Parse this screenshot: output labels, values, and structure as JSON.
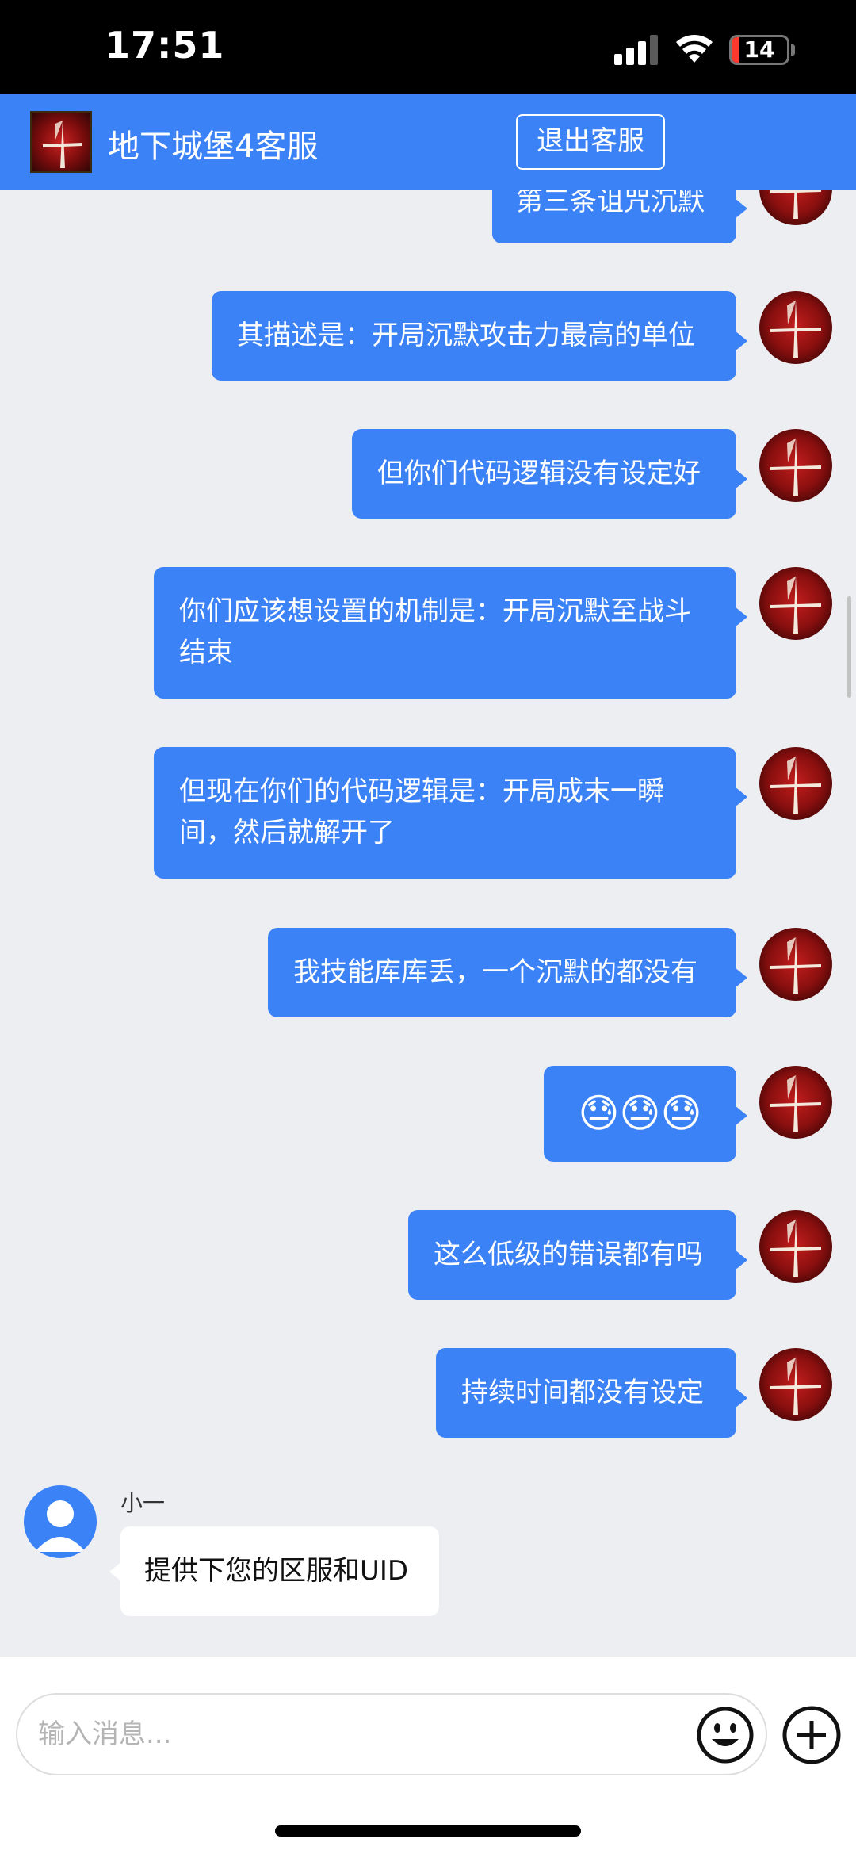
{
  "status_bar": {
    "time": "17:51",
    "battery": "14",
    "battery_level": 0.14
  },
  "header": {
    "title": "地下城堡4客服",
    "exit_label": "退出客服"
  },
  "messages": [
    {
      "side": "right",
      "text": "第三条诅咒沉默"
    },
    {
      "side": "right",
      "text": "其描述是：开局沉默攻击力最高的单位"
    },
    {
      "side": "right",
      "text": "但你们代码逻辑没有设定好"
    },
    {
      "side": "right",
      "text": "你们应该想设置的机制是：开局沉默至战斗结束"
    },
    {
      "side": "right",
      "text": "但现在你们的代码逻辑是：开局成末一瞬间，然后就解开了"
    },
    {
      "side": "right",
      "text": "我技能库库丢，一个沉默的都没有"
    },
    {
      "side": "right",
      "text": "😓😓😓"
    },
    {
      "side": "right",
      "text": "这么低级的错误都有吗"
    },
    {
      "side": "right",
      "text": "持续时间都没有设定"
    },
    {
      "side": "left",
      "sender": "小一",
      "text": "提供下您的区服和UID"
    }
  ],
  "input": {
    "placeholder": "输入消息..."
  },
  "colors": {
    "accent": "#3b82f6",
    "background": "#edeef2",
    "bubble_text": "#ffffff"
  },
  "icons": {
    "emoji": "smiley-face-icon",
    "plus": "plus-circle-icon"
  }
}
